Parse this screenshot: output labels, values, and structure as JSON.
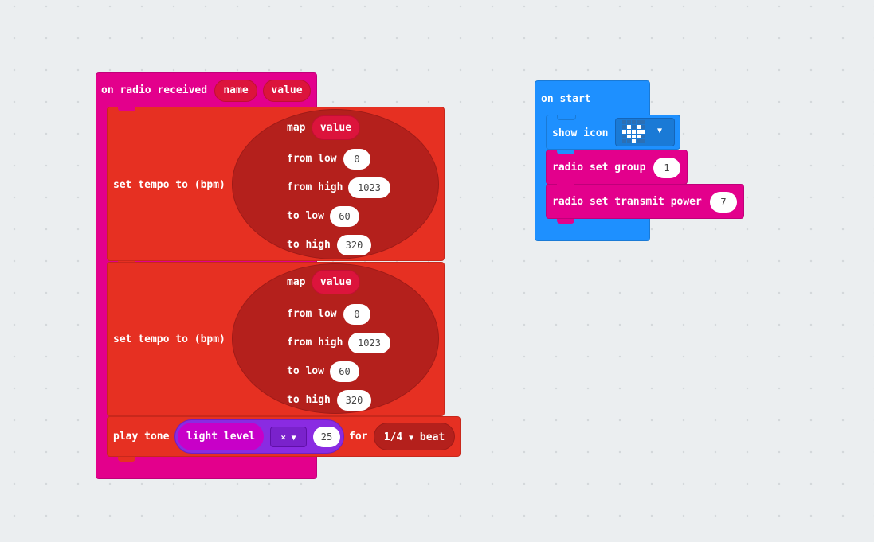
{
  "radio_handler": {
    "label": "on radio received",
    "param_name": "name",
    "param_value": "value"
  },
  "tempo1": {
    "label": "set tempo to (bpm)",
    "map_label": "map",
    "map_var": "value",
    "from_low_label": "from low",
    "from_low_val": "0",
    "from_high_label": "from high",
    "from_high_val": "1023",
    "to_low_label": "to low",
    "to_low_val": "60",
    "to_high_label": "to high",
    "to_high_val": "320"
  },
  "tempo2": {
    "label": "set tempo to (bpm)",
    "map_label": "map",
    "map_var": "value",
    "from_low_label": "from low",
    "from_low_val": "0",
    "from_high_label": "from high",
    "from_high_val": "1023",
    "to_low_label": "to low",
    "to_low_val": "60",
    "to_high_label": "to high",
    "to_high_val": "320"
  },
  "play_tone": {
    "label": "play tone",
    "sensor": "light level",
    "op": "×",
    "operand": "25",
    "for_label": "for",
    "duration": "1/4",
    "beat_label": "beat"
  },
  "on_start": {
    "label": "on start",
    "show_icon_label": "show icon",
    "group_label": "radio set group",
    "group_val": "1",
    "power_label": "radio set transmit power",
    "power_val": "7"
  },
  "colors": {
    "radio": "#e3008c",
    "music": "#e63022",
    "math": "#b4201c",
    "variables": "#dc143c",
    "input": "#c800c8",
    "basic": "#1e90ff",
    "workspace": "#ebeef0"
  },
  "icons": [
    "dropdown-caret-icon",
    "heart-led-icon"
  ]
}
